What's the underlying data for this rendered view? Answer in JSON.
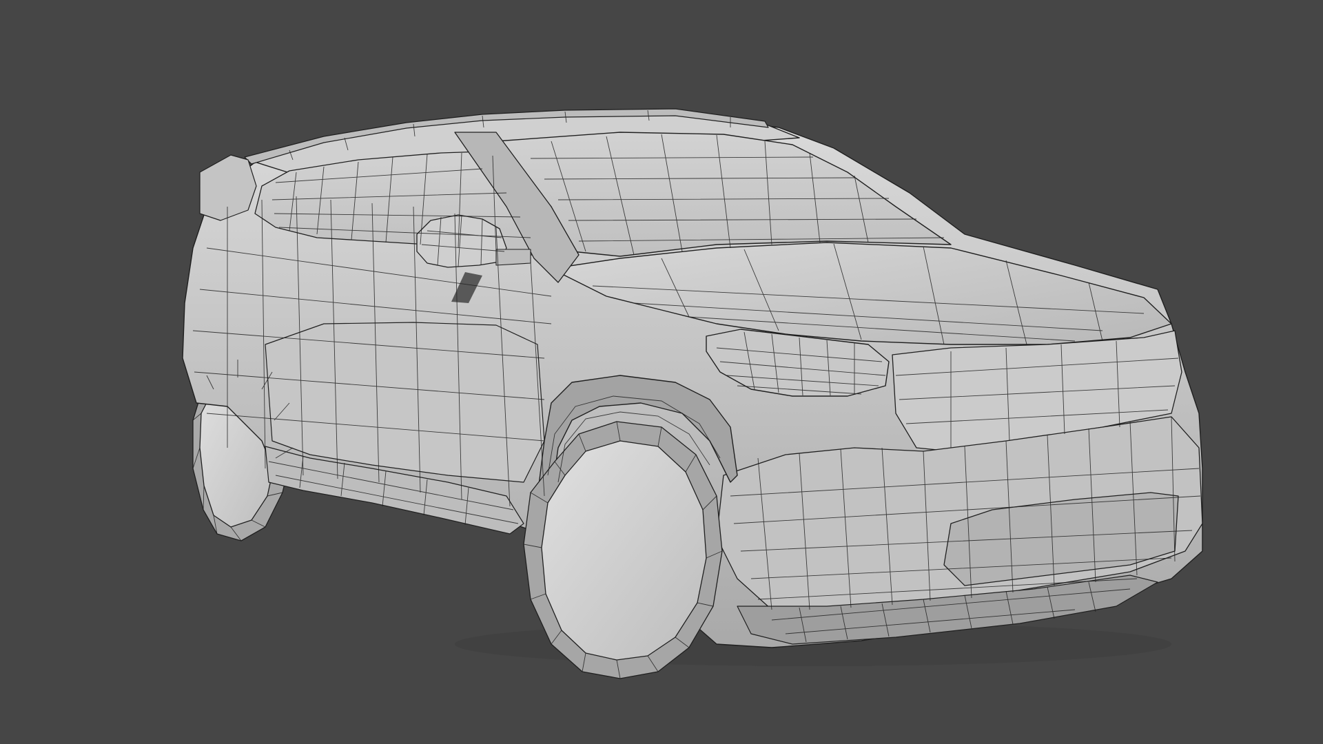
{
  "scene": {
    "subject_icon": "car-wireframe-icon",
    "display_mode": "wireframe-on-shaded",
    "colors": {
      "background": "#464646",
      "body_light": "#d6d6d6",
      "body_mid": "#b4b4b4",
      "body_dark": "#8a8a8a",
      "shadow": "#5f5f5f",
      "wire": "#1f1f1f",
      "wheel_face": "#cfcfcf",
      "wheel_rim": "#9d9d9d"
    }
  }
}
